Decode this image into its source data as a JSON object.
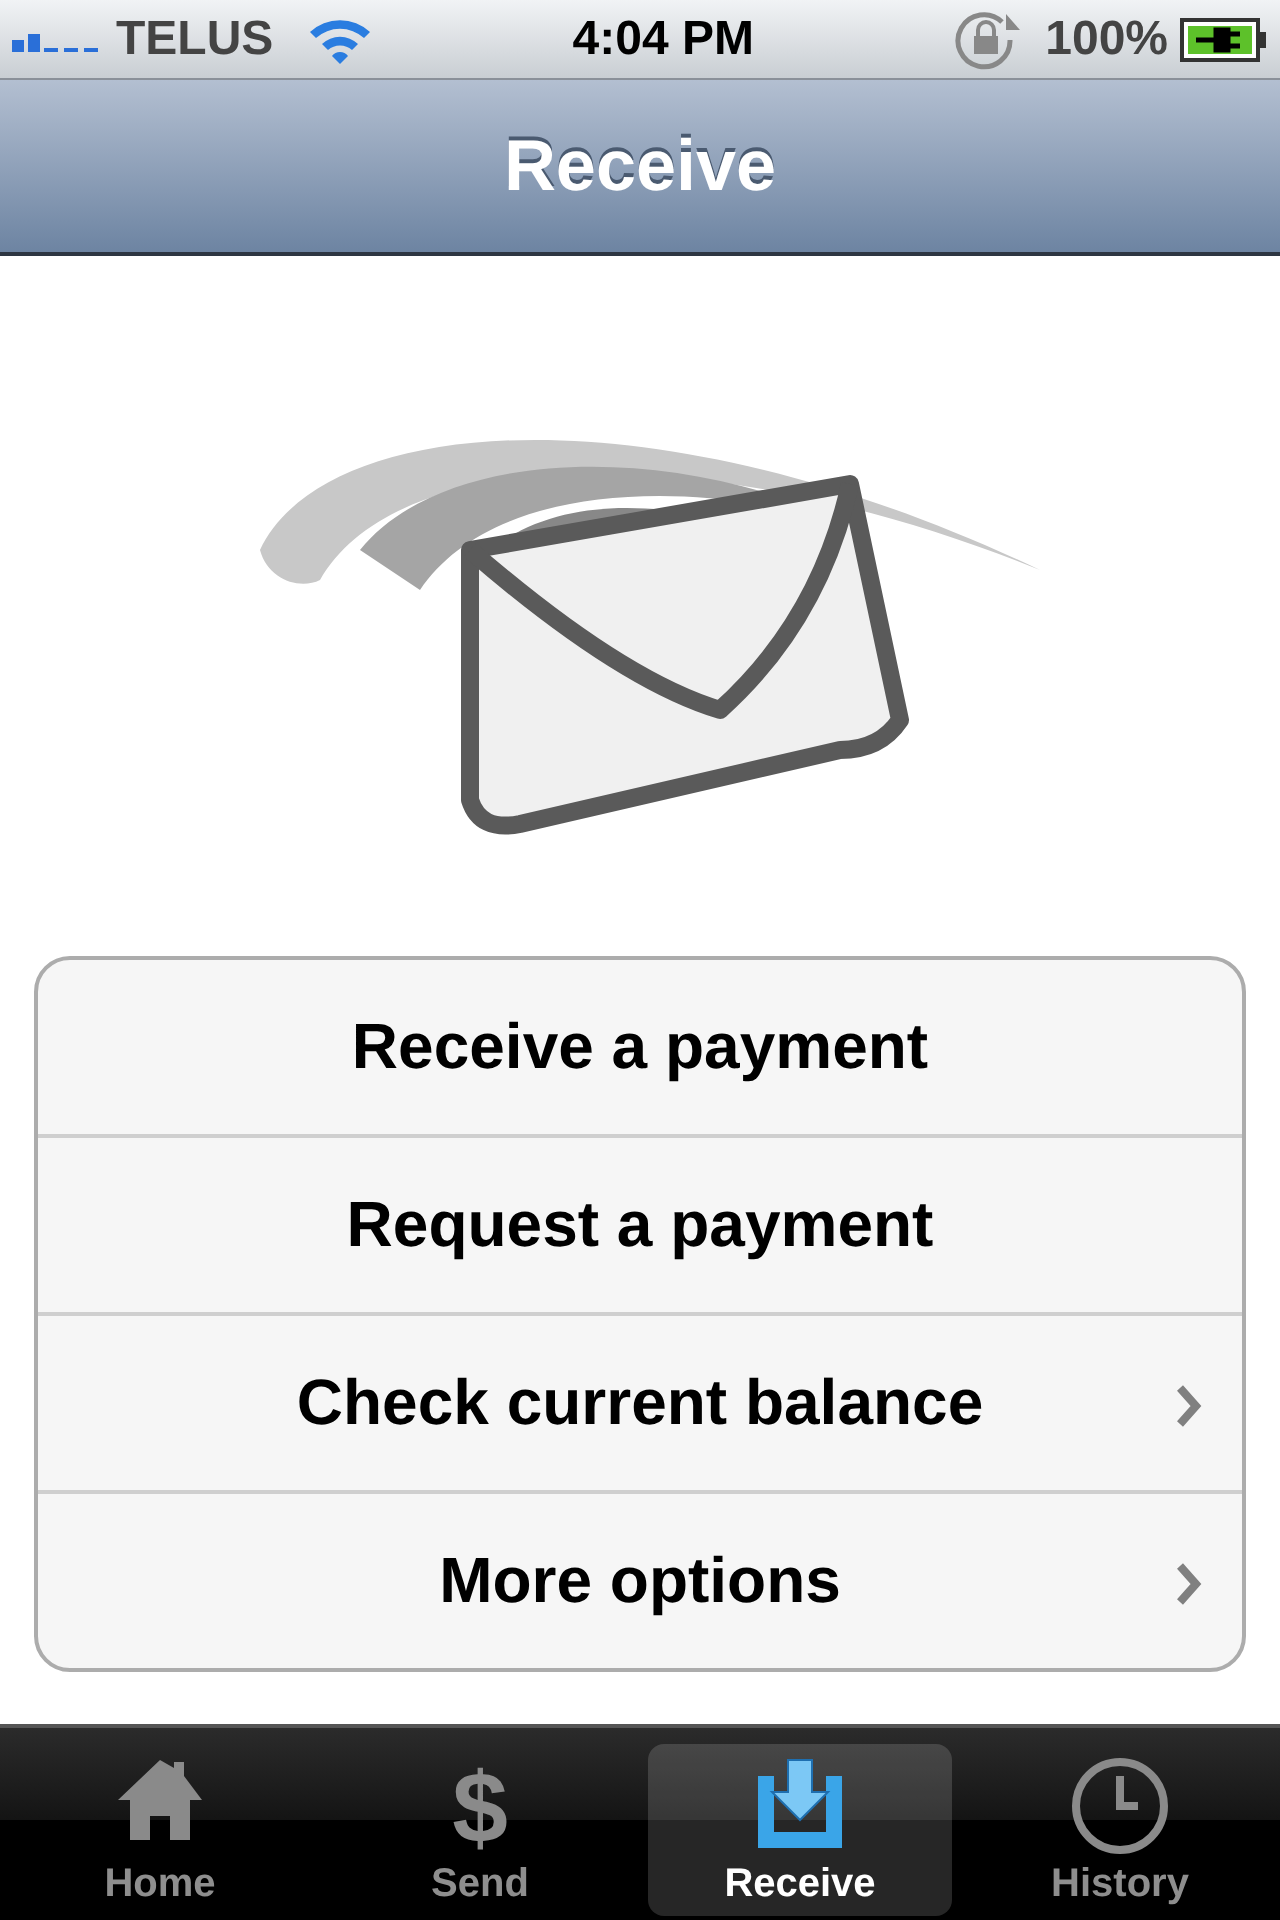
{
  "status_bar": {
    "carrier": "TELUS",
    "time": "4:04 PM",
    "battery": "100%"
  },
  "nav_bar": {
    "title": "Receive"
  },
  "menu": [
    {
      "label": "Receive a payment",
      "disclosure": false
    },
    {
      "label": "Request a payment",
      "disclosure": false
    },
    {
      "label": "Check current balance",
      "disclosure": true
    },
    {
      "label": "More options",
      "disclosure": true
    }
  ],
  "tab_bar": [
    {
      "label": "Home",
      "kind": "home",
      "selected": false
    },
    {
      "label": "Send",
      "kind": "glyph",
      "glyph": "$",
      "selected": false
    },
    {
      "label": "Receive",
      "kind": "tray",
      "selected": true
    },
    {
      "label": "History",
      "kind": "clock",
      "selected": false
    }
  ]
}
